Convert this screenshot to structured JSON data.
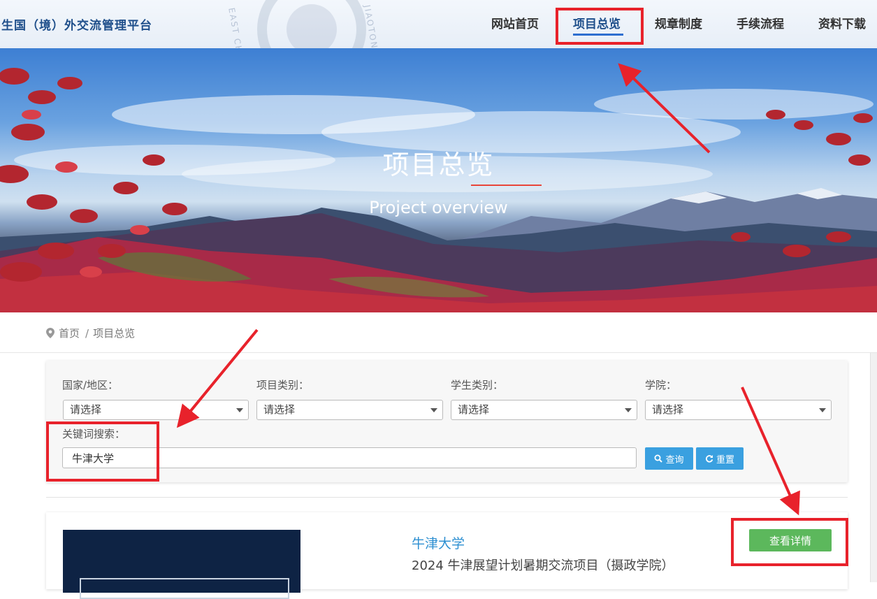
{
  "header": {
    "site_title": "生国（境）外交流管理平台",
    "watermark_left": "EAST CH",
    "watermark_right": "JIAOTONG",
    "nav": [
      {
        "label": "网站首页",
        "active": false
      },
      {
        "label": "项目总览",
        "active": true
      },
      {
        "label": "规章制度",
        "active": false
      },
      {
        "label": "手续流程",
        "active": false
      },
      {
        "label": "资料下载",
        "active": false
      }
    ]
  },
  "hero": {
    "title": "项目总览",
    "subtitle": "Project overview"
  },
  "breadcrumb": {
    "home": "首页",
    "separator": "/",
    "current": "项目总览"
  },
  "filters": {
    "country_label": "国家/地区：",
    "project_type_label": "项目类别：",
    "student_type_label": "学生类别：",
    "college_label": "学院：",
    "select_placeholder": "请选择",
    "keyword_label": "关键词搜索：",
    "keyword_value": "牛津大学",
    "search_button": "查询",
    "reset_button": "重置"
  },
  "results": [
    {
      "university": "牛津大学",
      "project": "2024 牛津展望计划暑期交流项目（摄政学院）",
      "detail_button": "查看详情"
    }
  ],
  "colors": {
    "brand_blue": "#1f4f8b",
    "nav_underline": "#2f6fd0",
    "hero_line": "#e8463a",
    "button_blue": "#3aa0e0",
    "button_green": "#5cb85c",
    "link_blue": "#2d8fd1",
    "annotation_red": "#e8222b"
  }
}
